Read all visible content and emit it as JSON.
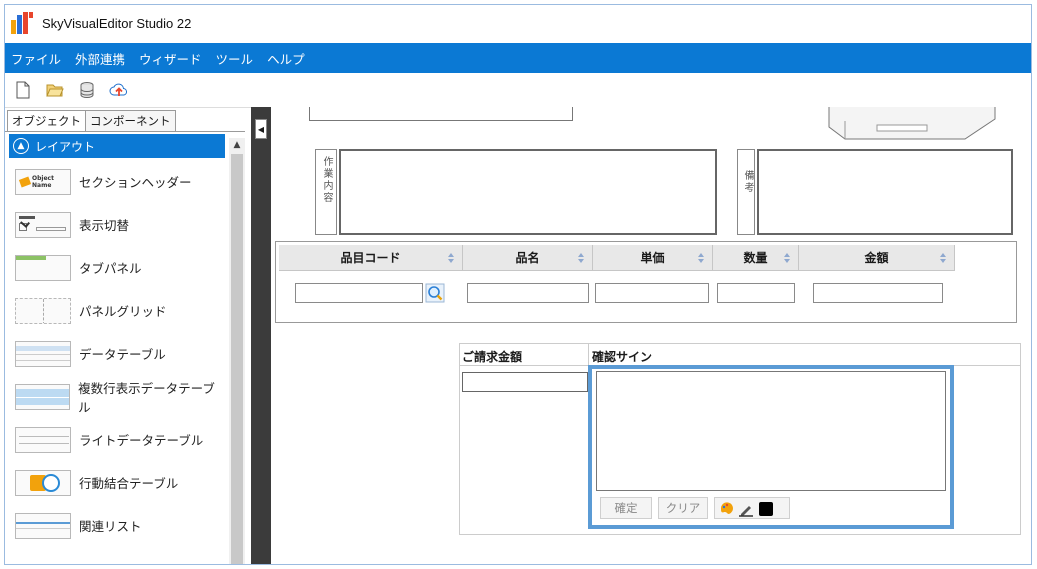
{
  "app": {
    "title": "SkyVisualEditor Studio 22"
  },
  "menu": {
    "items": [
      "ファイル",
      "外部連携",
      "ウィザード",
      "ツール",
      "ヘルプ"
    ]
  },
  "toolbar": {
    "icons": [
      "new-file-icon",
      "open-folder-icon",
      "database-icon",
      "cloud-upload-icon"
    ]
  },
  "left_panel": {
    "tabs": [
      "オブジェクト",
      "コンポーネント"
    ],
    "section": "レイアウト",
    "items": [
      {
        "label": "セクションヘッダー",
        "thumb_text": "Object Name"
      },
      {
        "label": "表示切替"
      },
      {
        "label": "タブパネル"
      },
      {
        "label": "パネルグリッド"
      },
      {
        "label": "データテーブル"
      },
      {
        "label": "複数行表示データテーブル"
      },
      {
        "label": "ライトデータテーブル"
      },
      {
        "label": "行動結合テーブル"
      },
      {
        "label": "関連リスト"
      }
    ]
  },
  "canvas": {
    "work_label": "作業内容",
    "notes_label": "備考",
    "grid_headers": [
      "品目コード",
      "品名",
      "単価",
      "数量",
      "金額"
    ],
    "billing_label": "ご請求金額",
    "signature_label": "確認サイン",
    "confirm_button": "確定",
    "clear_button": "クリア"
  },
  "colors": {
    "accent": "#0b79d4",
    "highlight": "#5b9bd5"
  }
}
